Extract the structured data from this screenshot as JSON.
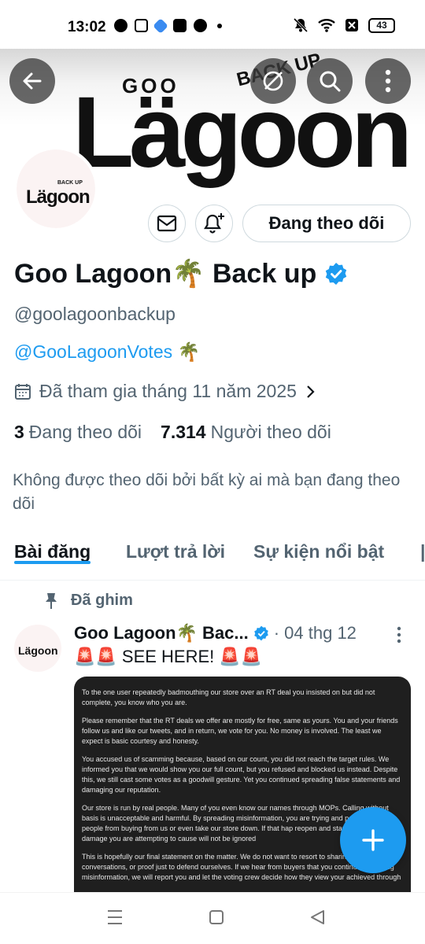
{
  "status_bar": {
    "time": "13:02",
    "left_icons": [
      "facebook-icon",
      "instagram-icon",
      "messenger-icon",
      "shopping-bag-icon",
      "globe-icon"
    ],
    "right_icons": [
      "mute-icon",
      "wifi-icon",
      "no-sim-icon"
    ],
    "battery": "43"
  },
  "banner": {
    "brand_small": "GOO",
    "brand_main": "Lägoon",
    "brand_tag": "BACK UP"
  },
  "top_bar": {
    "back_icon": "back-arrow-icon",
    "grok_icon": "grok-icon",
    "search_icon": "search-icon",
    "more_icon": "more-vertical-icon"
  },
  "profile": {
    "avatar_text": "Lägoon",
    "avatar_tag": "BACK UP",
    "message_icon": "mail-icon",
    "notify_icon": "bell-plus-icon",
    "following_label": "Đang theo dõi",
    "display_name": "Goo Lagoon🌴 Back up",
    "handle": "@goolagoonbackup",
    "bio_link": "@GooLagoonVotes",
    "bio_emoji": "🌴",
    "joined": "Đã tham gia tháng 11 năm 2025",
    "following_count": "3",
    "following_label_text": "Đang theo dõi",
    "followers_count": "7.314",
    "followers_label_text": "Người theo dõi",
    "not_followed_text": "Không được theo dõi bởi bất kỳ ai mà bạn đang theo dõi"
  },
  "tabs": [
    {
      "label": "Bài đăng",
      "active": true
    },
    {
      "label": "Lượt trả lời",
      "active": false
    },
    {
      "label": "Sự kiện nổi bật",
      "active": false
    }
  ],
  "pinned_tweet": {
    "pinned_label": "Đã ghim",
    "name": "Goo Lagoon🌴 Bac...",
    "date": "· 04 thg 12",
    "text": "🚨🚨 SEE HERE! 🚨🚨",
    "media_paragraphs": [
      "To the one user repeatedly badmouthing our store over an RT deal you insisted on but did not complete, you know who you are.",
      "Please remember that the RT deals we offer are mostly for free, same as yours. You and your friends follow us and like our tweets, and in return, we vote for you. No money is involved. The least we expect is basic courtesy and honesty.",
      "You accused us of scamming because, based on our count, you did not reach the target rules. We informed you that we would show you our full count, but you refused and blocked us instead. Despite this, we still cast some votes as a goodwill gesture. Yet you continued spreading false statements and damaging our reputation.",
      "Our store is run by real people. Many of you even know our names through MOPs. Calling without basis is unacceptable and harmful. By spreading misinformation, you are trying and possibly stop people from buying from us or even take our store down. If that hap reopen and start fresh, but the damage you are attempting to cause will not be ignored",
      "This is hopefully our final statement on the matter. We do not want to resort to sharing scre conversations, or proof just to defend ourselves. If we hear from buyers that you continue spreading misinformation, we will report you and let the voting crew decide how they view your achieved through"
    ]
  },
  "fab": {
    "icon": "plus-icon"
  },
  "nav_bar": {
    "icons": [
      "recents-icon",
      "home-icon",
      "back-icon"
    ]
  }
}
